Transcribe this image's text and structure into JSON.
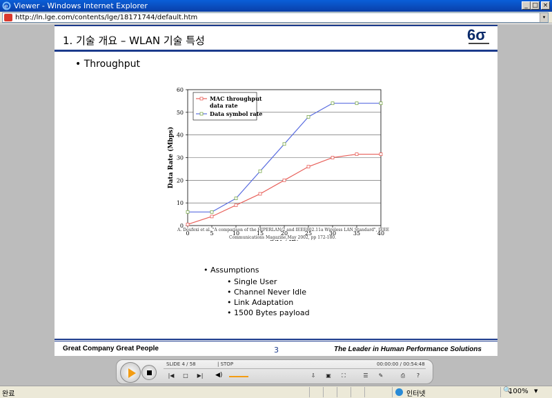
{
  "window": {
    "title": "Viewer - Windows Internet Explorer",
    "min_label": "_",
    "max_label": "□",
    "close_label": "×"
  },
  "address": {
    "url": "http://ln.lge.com/contents/lge/18171744/default.htm",
    "dropdown": "▾"
  },
  "slide": {
    "title": "1. 기술 개요 – WLAN 기술 특성",
    "logo_text": "6σ",
    "bullet_main": "• Throughput",
    "citation_line1": "A. Doufexi et al.,\"A comparison of the HIPERLAN/2 and IEEE802.11a Wireless LAN Standard\", IEEE",
    "citation_line2": "Communications Magazine,May 2002, pp 172-180.",
    "assumptions_label": "•   Assumptions",
    "assumptions": [
      "• Single User",
      "• Channel Never Idle",
      "• Link Adaptation",
      "• 1500 Bytes payload"
    ],
    "footer_left": "Great Company   Great People",
    "page_number": "3",
    "footer_right": "The Leader in Human Performance Solutions"
  },
  "chart_data": {
    "type": "line",
    "x": [
      0,
      5,
      10,
      15,
      20,
      25,
      30,
      35,
      40
    ],
    "xlabel": "C/N (dB)",
    "ylabel": "Data Rate (Mbps)",
    "xlim": [
      0,
      40
    ],
    "ylim": [
      0,
      60
    ],
    "xticks": [
      "0",
      "5",
      "10",
      "15",
      "20",
      "25",
      "30",
      "35",
      "40"
    ],
    "yticks": [
      "0",
      "10",
      "20",
      "30",
      "40",
      "50",
      "60"
    ],
    "grid": true,
    "legend_position": "top-left",
    "series": [
      {
        "name": "MAC throughput data rate",
        "color": "#e8605a",
        "values": [
          0.5,
          4,
          9,
          14,
          20,
          26,
          30,
          31.5,
          31.5
        ]
      },
      {
        "name": "Data symbol rate",
        "color": "#5a6de0",
        "values": [
          6,
          6,
          12,
          24,
          36,
          48,
          54,
          54,
          54
        ]
      }
    ],
    "legend_labels": [
      "MAC throughput",
      "data rate",
      "Data symbol rate"
    ]
  },
  "player": {
    "slide_label": "SLIDE  4 /   58",
    "state_label": "|  STOP",
    "time_label": "00:00:00 / 00:54:48"
  },
  "status": {
    "text": "완료",
    "zone": "인터넷",
    "zoom": "100%"
  }
}
